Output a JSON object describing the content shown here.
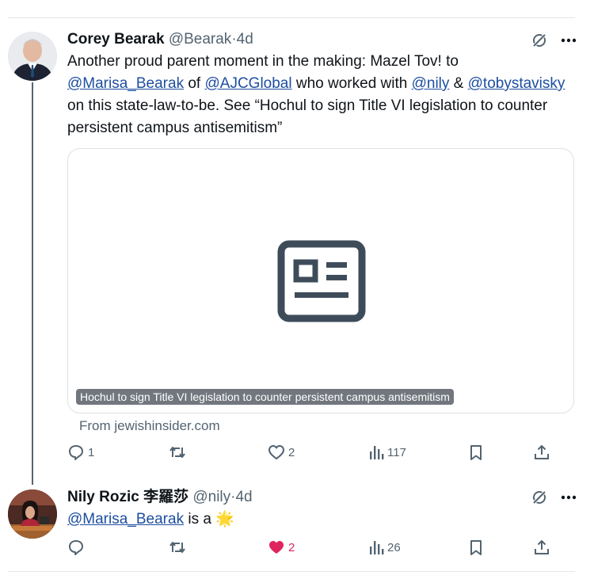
{
  "tweets": [
    {
      "name": "Corey Bearak",
      "handle": "@Bearak",
      "separator": "·",
      "age": "4d",
      "text_parts": [
        {
          "t": "Another proud parent moment in the making: Mazel Tov! to ",
          "m": false
        },
        {
          "t": "@Marisa_Bearak",
          "m": true
        },
        {
          "t": " of ",
          "m": false
        },
        {
          "t": "@AJCGlobal",
          "m": true
        },
        {
          "t": " who worked with ",
          "m": false
        },
        {
          "t": "@nily",
          "m": true
        },
        {
          "t": " & ",
          "m": false
        },
        {
          "t": "@tobystavisky",
          "m": true
        },
        {
          "t": " on this state-law-to-be. See “Hochul to sign Title VI legislation to counter persistent campus antisemitism”",
          "m": false
        }
      ],
      "card": {
        "caption": "Hochul to sign Title VI legislation to counter persistent campus antisemitism",
        "source": "From jewishinsider.com",
        "icon": "article-icon"
      },
      "actions": {
        "replies": "1",
        "reposts": "",
        "likes": "2",
        "views": "117",
        "liked": false
      }
    },
    {
      "name": "Nily Rozic 李羅莎",
      "handle": "@nily",
      "separator": "·",
      "age": "4d",
      "text_parts": [
        {
          "t": "@Marisa_Bearak",
          "m": true
        },
        {
          "t": " is a ",
          "m": false
        }
      ],
      "emoji": "🌟",
      "actions": {
        "replies": "",
        "reposts": "",
        "likes": "2",
        "views": "26",
        "liked": true
      }
    }
  ],
  "colors": {
    "text": "#0f1419",
    "muted": "#536471",
    "link": "#1d4ea0",
    "like": "#e0245e",
    "divider": "#e6e6e6"
  }
}
